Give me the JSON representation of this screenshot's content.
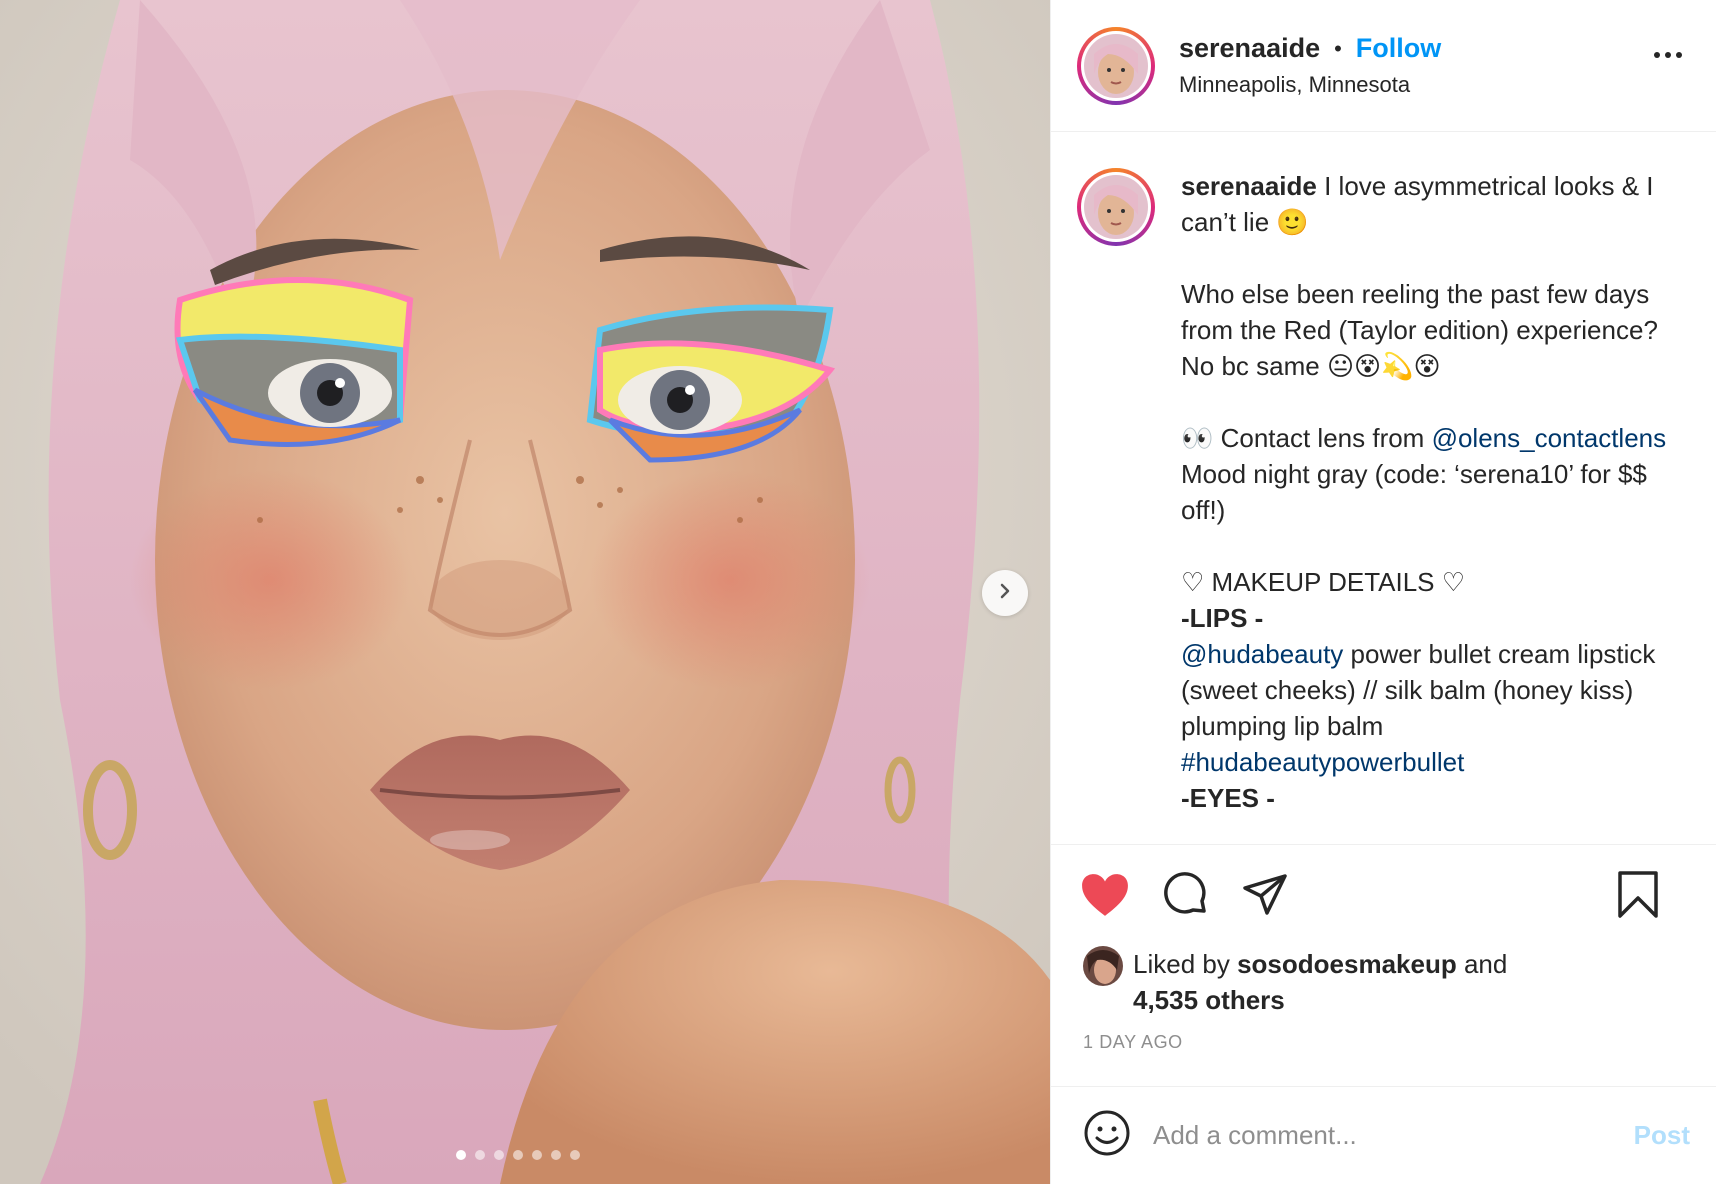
{
  "user": {
    "username": "serenaaide",
    "follow_label": "Follow",
    "separator": "•",
    "location": "Minneapolis, Minnesota"
  },
  "caption": {
    "username": "serenaaide",
    "line1": " I love asymmetrical looks & I can’t lie 🙂",
    "para2": "Who else been reeling the past few days from the Red (Taylor edition) experience? No bc same 😐😵💫😵",
    "para3_prefix": "👀 Contact lens from ",
    "mention1": "@olens_contactlens",
    "para3_suffix": " Mood night gray (code: ‘serena10’ for $$ off!)",
    "makeup_header": "♡ MAKEUP DETAILS ♡",
    "lips_header": "-LIPS -",
    "mention2": "@hudabeauty",
    "lips_text": " power bullet cream lipstick (sweet cheeks) // silk balm (honey kiss) plumping lip balm",
    "hashtag": "#hudabeautypowerbullet",
    "eyes_header": "-EYES -"
  },
  "likes": {
    "prefix": "Liked by ",
    "liker": "sosodoesmakeup",
    "middle": " and",
    "others": "4,535 others"
  },
  "timestamp": "1 DAY AGO",
  "comment": {
    "placeholder": "Add a comment...",
    "post_label": "Post"
  },
  "carousel": {
    "total_slides": 7,
    "active_slide": 1
  },
  "colors": {
    "follow": "#0095f6",
    "link": "#00376b",
    "like_heart": "#ed4956",
    "post_disabled": "#b2dffc",
    "muted": "#8e8e8e"
  },
  "icons": [
    "chevron-right-icon",
    "more-icon",
    "heart-icon",
    "comment-icon",
    "share-icon",
    "bookmark-icon",
    "smile-icon"
  ]
}
